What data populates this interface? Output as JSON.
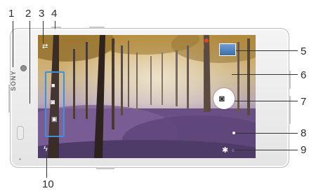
{
  "brand": "SONY",
  "callouts": {
    "n1": "1",
    "n2": "2",
    "n3": "3",
    "n4": "4",
    "n5": "5",
    "n6": "6",
    "n7": "7",
    "n8": "8",
    "n9": "9",
    "n10": "10"
  },
  "camera_ui": {
    "front_camera_switch": "camera-switch-icon",
    "mode_selector": [
      "video-icon",
      "camera-icon",
      "scene-icon"
    ],
    "shutter": "camera-icon",
    "settings": "gear-icon",
    "flash": "flash-icon",
    "thumbnail": "photo-thumbnail"
  },
  "colors": {
    "mode_panel_border": "#3f8fd9",
    "screen_bg": "#6d6c7c"
  }
}
